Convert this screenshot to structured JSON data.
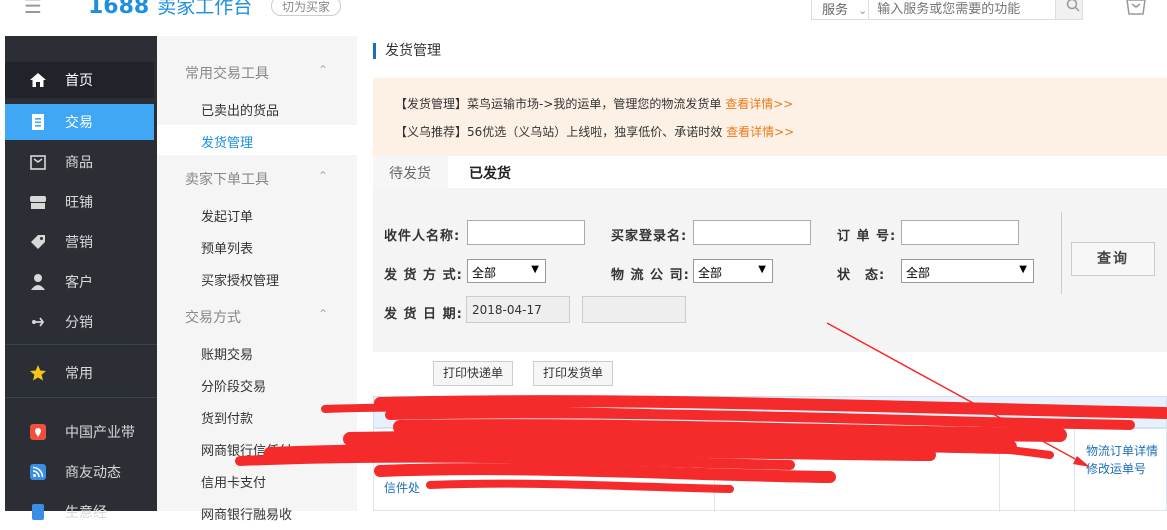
{
  "topbar": {
    "logo_number": "1688",
    "logo_text": "卖家工作台",
    "switch_label": "切为买家",
    "search_scope": "服务",
    "search_placeholder": "输入服务或您需要的功能"
  },
  "sidebar": {
    "items": [
      {
        "label": "首页",
        "icon": "home-icon"
      },
      {
        "label": "交易",
        "icon": "document-icon"
      },
      {
        "label": "商品",
        "icon": "bag-icon"
      },
      {
        "label": "旺铺",
        "icon": "shop-icon"
      },
      {
        "label": "营销",
        "icon": "tag-icon"
      },
      {
        "label": "客户",
        "icon": "user-icon"
      },
      {
        "label": "分销",
        "icon": "share-icon"
      },
      {
        "label": "常用",
        "icon": "star-icon"
      },
      {
        "label": "中国产业带",
        "icon": "location-icon"
      },
      {
        "label": "商友动态",
        "icon": "rss-icon"
      },
      {
        "label": "生意经",
        "icon": "book-icon"
      }
    ],
    "active_index": 1
  },
  "subnav": {
    "groups": [
      {
        "title": "常用交易工具",
        "items": [
          "已卖出的货品",
          "发货管理"
        ]
      },
      {
        "title": "卖家下单工具",
        "items": [
          "发起订单",
          "预单列表",
          "买家授权管理"
        ]
      },
      {
        "title": "交易方式",
        "items": [
          "账期交易",
          "分阶段交易",
          "货到付款",
          "网商银行信任付",
          "信用卡支付",
          "网商银行融易收"
        ]
      }
    ],
    "active_item": "发货管理"
  },
  "main": {
    "title": "发货管理",
    "notices": [
      {
        "text": "【发货管理】菜鸟运输市场->我的运单，管理您的物流发货单",
        "link": "查看详情>>"
      },
      {
        "text": "【义乌推荐】56优选（义乌站）上线啦，独享低价、承诺时效",
        "link": "查看详情>>"
      }
    ],
    "tabs": [
      "待发货",
      "已发货"
    ],
    "active_tab": "已发货",
    "filters": {
      "receiver_label": "收件人名称:",
      "buyer_label": "买家登录名:",
      "order_label": "订 单 号:",
      "ship_method_label": "发 货 方 式:",
      "ship_method_value": "全部",
      "logistics_label": "物 流 公 司:",
      "logistics_value": "全部",
      "status_label": "状　态:",
      "status_value": "全部",
      "date_label": "发 货 日 期:",
      "date_from": "2018-04-17",
      "date_to": "",
      "query_button": "查询"
    },
    "print_express": "打印快递单",
    "print_delivery": "打印发货单",
    "row_links": [
      "物流订单详情",
      "修改运单号"
    ],
    "row_partial_text": "信件处"
  },
  "colors": {
    "accent": "#3fa7f5",
    "link": "#1c6fb8",
    "orange_link": "#e87a1c",
    "sidebar_bg": "#2b2f35",
    "redaction": "#f52b2b"
  }
}
